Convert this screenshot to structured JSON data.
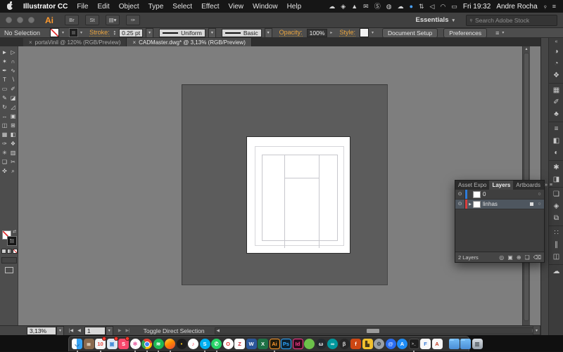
{
  "icons": {
    "close": "×",
    "dropdown": "▾",
    "dropdown_side": "▸",
    "stepper_up": "▴",
    "stepper_down": "▾",
    "scroll_up": "▴",
    "scroll_down": "▾",
    "scroll_left": "◀",
    "scroll_right": "▶",
    "nav_first": "|◀",
    "nav_prev": "◀",
    "nav_next": "▶",
    "nav_last": "▶|",
    "collapse": "«",
    "panel_chevron": "»",
    "panel_menu": "≡",
    "swap": "⇄",
    "search": "⌕"
  },
  "menubar": {
    "items": [
      "Illustrator CC",
      "File",
      "Edit",
      "Object",
      "Type",
      "Select",
      "Effect",
      "View",
      "Window",
      "Help"
    ],
    "status_icons": [
      {
        "name": "cloud-sync-icon",
        "glyph": "☁"
      },
      {
        "name": "shield-app-icon",
        "glyph": "◈"
      },
      {
        "name": "drive-triangle-icon",
        "glyph": "▲"
      },
      {
        "name": "chat-icon",
        "glyph": "✉"
      },
      {
        "name": "skype-status-icon",
        "glyph": "Ⓢ"
      },
      {
        "name": "globe-app-icon",
        "glyph": "◍"
      },
      {
        "name": "cloud2-icon",
        "glyph": "☁"
      },
      {
        "name": "blue-globe-icon",
        "glyph": "●",
        "color": "#4aa3ff"
      },
      {
        "name": "updown-arrows-icon",
        "glyph": "⇅"
      },
      {
        "name": "volume-icon",
        "glyph": "◁"
      },
      {
        "name": "wifi-icon",
        "glyph": "◠"
      },
      {
        "name": "battery-icon",
        "glyph": "▭"
      }
    ],
    "clock": "Fri 19:32",
    "user": "Andre Rocha",
    "search_icon": "⌕",
    "list_icon": "≡"
  },
  "titlebar": {
    "app_logo": "Ai",
    "icons": [
      {
        "name": "bridge-icon",
        "glyph": "Br"
      },
      {
        "name": "adobe-stock-icon",
        "glyph": "St"
      },
      {
        "name": "arrange-documents-icon",
        "glyph": "▤▾"
      },
      {
        "name": "share-icon",
        "glyph": "✑"
      }
    ],
    "workspace": "Essentials",
    "search_placeholder": "Search Adobe Stock"
  },
  "controlbar": {
    "selection_label": "No Selection",
    "stroke_label": "Stroke:",
    "stroke_weight": "0.25 pt",
    "width_profile": "Uniform",
    "brush": "Basic",
    "opacity_label": "Opacity:",
    "opacity_value": "100%",
    "style_label": "Style:",
    "document_setup": "Document Setup",
    "preferences": "Preferences"
  },
  "tabs": [
    {
      "title": "portaVinil @ 120% (RGB/Preview)",
      "active": false
    },
    {
      "title": "CADMaster.dwg* @ 3,13% (RGB/Preview)",
      "active": true
    }
  ],
  "toolbar": {
    "tools": [
      {
        "name": "selection-tool",
        "glyph": "►"
      },
      {
        "name": "direct-selection-tool",
        "glyph": "▷"
      },
      {
        "name": "magic-wand-tool",
        "glyph": "✶"
      },
      {
        "name": "lasso-tool",
        "glyph": "∩"
      },
      {
        "name": "pen-tool",
        "glyph": "✒"
      },
      {
        "name": "curvature-tool",
        "glyph": "∿"
      },
      {
        "name": "type-tool",
        "glyph": "T"
      },
      {
        "name": "line-segment-tool",
        "glyph": "∖"
      },
      {
        "name": "rectangle-tool",
        "glyph": "▭"
      },
      {
        "name": "paintbrush-tool",
        "glyph": "✐"
      },
      {
        "name": "pencil-tool",
        "glyph": "✎"
      },
      {
        "name": "eraser-tool",
        "glyph": "◪"
      },
      {
        "name": "rotate-tool",
        "glyph": "↻"
      },
      {
        "name": "scale-tool",
        "glyph": "◿"
      },
      {
        "name": "width-tool",
        "glyph": "↔"
      },
      {
        "name": "free-transform-tool",
        "glyph": "▣"
      },
      {
        "name": "shape-builder-tool",
        "glyph": "◫"
      },
      {
        "name": "perspective-grid-tool",
        "glyph": "⊞"
      },
      {
        "name": "mesh-tool",
        "glyph": "▦"
      },
      {
        "name": "gradient-tool",
        "glyph": "◧"
      },
      {
        "name": "eyedropper-tool",
        "glyph": "✑"
      },
      {
        "name": "blend-tool",
        "glyph": "❖"
      },
      {
        "name": "symbol-sprayer-tool",
        "glyph": "✳"
      },
      {
        "name": "column-graph-tool",
        "glyph": "▥"
      },
      {
        "name": "artboard-tool",
        "glyph": "❏"
      },
      {
        "name": "slice-tool",
        "glyph": "✂"
      },
      {
        "name": "hand-tool",
        "glyph": "✜"
      },
      {
        "name": "zoom-tool",
        "glyph": "⌕"
      }
    ]
  },
  "right_dock": {
    "groups": [
      [
        {
          "name": "color-panel-icon",
          "glyph": "◑"
        },
        {
          "name": "color-guide-panel-icon",
          "glyph": "◔"
        },
        {
          "name": "color-themes-panel-icon",
          "glyph": "❖"
        }
      ],
      [
        {
          "name": "swatches-panel-icon",
          "glyph": "▦"
        },
        {
          "name": "brushes-panel-icon",
          "glyph": "✐"
        },
        {
          "name": "symbols-panel-icon",
          "glyph": "♣"
        }
      ],
      [
        {
          "name": "stroke-panel-icon",
          "glyph": "≡"
        },
        {
          "name": "gradient-panel-icon",
          "glyph": "◧"
        },
        {
          "name": "transparency-panel-icon",
          "glyph": "◐"
        }
      ],
      [
        {
          "name": "appearance-panel-icon",
          "glyph": "✱"
        },
        {
          "name": "graphic-styles-panel-icon",
          "glyph": "◨"
        }
      ],
      [
        {
          "name": "artboards-panel-icon",
          "glyph": "❏"
        },
        {
          "name": "layers-panel-icon",
          "glyph": "◈"
        },
        {
          "name": "asset-export-panel-icon",
          "glyph": "⧉"
        }
      ],
      [
        {
          "name": "transform-panel-icon",
          "glyph": "∷"
        },
        {
          "name": "align-panel-icon",
          "glyph": "∥"
        },
        {
          "name": "pathfinder-panel-icon",
          "glyph": "◫"
        }
      ],
      [
        {
          "name": "cc-libraries-panel-icon",
          "glyph": "☁"
        }
      ]
    ]
  },
  "layers_panel": {
    "tabs": [
      "Asset Expo",
      "Layers",
      "Artboards"
    ],
    "active_tab": "Layers",
    "row_icons": {
      "eye": "⊙",
      "expand": "▶",
      "target": "○"
    },
    "rows": [
      {
        "name": "0",
        "color": "#2e7bd9",
        "selected": false,
        "expandable": false
      },
      {
        "name": "linhas",
        "color": "#d94040",
        "selected": true,
        "expandable": true
      }
    ],
    "footer": "2 Layers",
    "footer_icons": [
      {
        "name": "locate-object-icon",
        "glyph": "◎"
      },
      {
        "name": "clipping-mask-icon",
        "glyph": "▣"
      },
      {
        "name": "new-sublayer-icon",
        "glyph": "⊕"
      },
      {
        "name": "new-layer-icon",
        "glyph": "❏"
      },
      {
        "name": "delete-layer-icon",
        "glyph": "⌫"
      }
    ]
  },
  "statusbar": {
    "zoom": "3,13%",
    "artboard": "1",
    "status": "Toggle Direct Selection"
  },
  "dock": {
    "items": [
      {
        "name": "finder",
        "glyph": "◡",
        "fg": "#1a5f9e",
        "running": true
      },
      {
        "name": "notebook-app",
        "glyph": "≣",
        "bg": "#8a6a4e",
        "fg": "#e9dcc8"
      },
      {
        "name": "calendar",
        "glyph": "10",
        "bg": "#f4f4f4",
        "fg": "#e8463c",
        "badge": true,
        "running": true
      },
      {
        "name": "photos-album",
        "glyph": "▣",
        "bg": "#dfe9f2",
        "fg": "#4a90d9",
        "badge": true
      },
      {
        "name": "setapp",
        "glyph": "S",
        "bg": "#f5476b",
        "fg": "#ffffff",
        "badge": true
      },
      {
        "name": "photos",
        "glyph": "✻",
        "bg": "#ffffff",
        "fg": "#e85da0",
        "shape": "circle",
        "running": true
      },
      {
        "name": "chrome",
        "glyph": "",
        "shape": "circle",
        "running": true
      },
      {
        "name": "spotify",
        "glyph": "≋",
        "bg": "#1db954",
        "fg": "#ffffff",
        "shape": "circle",
        "running": true
      },
      {
        "name": "firefox",
        "glyph": "",
        "shape": "circle",
        "running": true
      },
      {
        "name": "vinyl-app",
        "glyph": "•",
        "bg": "#1c1c1c",
        "fg": "#f5c518",
        "shape": "circle"
      },
      {
        "name": "music",
        "glyph": "♪",
        "bg": "#ffffff",
        "fg": "#f5344f",
        "shape": "circle"
      },
      {
        "name": "skype",
        "glyph": "S",
        "bg": "#00aff0",
        "fg": "#ffffff",
        "shape": "circle",
        "running": true
      },
      {
        "name": "whatsapp",
        "glyph": "✆",
        "bg": "#25d366",
        "fg": "#ffffff",
        "shape": "circle",
        "running": true
      },
      {
        "name": "opera",
        "glyph": "O",
        "bg": "#ffffff",
        "fg": "#e8322e",
        "shape": "circle"
      },
      {
        "name": "zotero",
        "glyph": "Z",
        "bg": "#fdfdfd",
        "fg": "#cc2936"
      },
      {
        "name": "word",
        "glyph": "W",
        "bg": "#2b579a",
        "fg": "#ffffff"
      },
      {
        "name": "excel",
        "glyph": "X",
        "bg": "#1e7145",
        "fg": "#ffffff"
      },
      {
        "name": "illustrator",
        "glyph": "Ai",
        "bg": "#231c0c",
        "fg": "#ff9a2e",
        "running": true
      },
      {
        "name": "photoshop",
        "glyph": "Ps",
        "bg": "#0c2334",
        "fg": "#31a8ff"
      },
      {
        "name": "indesign",
        "glyph": "Id",
        "bg": "#2e0b1d",
        "fg": "#ff3f8e"
      },
      {
        "name": "green-app",
        "glyph": "",
        "bg": "#6cc04a",
        "shape": "circle"
      },
      {
        "name": "github",
        "glyph": "ω",
        "bg": "#24292e",
        "fg": "#ffffff",
        "shape": "circle"
      },
      {
        "name": "arduino",
        "glyph": "∞",
        "bg": "#00979d",
        "fg": "#ffffff",
        "shape": "circle"
      },
      {
        "name": "processing",
        "glyph": "β",
        "bg": "#262626",
        "fg": "#dcdcdc",
        "shape": "circle"
      },
      {
        "name": "fritzing",
        "glyph": "f",
        "bg": "#cd4713",
        "fg": "#ffffff"
      },
      {
        "name": "truck-app",
        "glyph": "▙",
        "bg": "#f2c12e",
        "fg": "#4a3a1a"
      },
      {
        "name": "gear-app",
        "glyph": "⚙",
        "bg": "#9aa0a6",
        "fg": "#40464c",
        "shape": "circle"
      },
      {
        "name": "blue-app",
        "glyph": "@",
        "bg": "#2a6df0",
        "fg": "#cfe0ff",
        "shape": "circle"
      },
      {
        "name": "appstore",
        "glyph": "A",
        "bg": "#1f8df5",
        "fg": "#ffffff",
        "shape": "circle"
      },
      {
        "name": "terminal",
        "glyph": ">_",
        "bg": "#1e1e1e",
        "fg": "#cfcfcf",
        "running": true
      },
      {
        "name": "font-app",
        "glyph": "F",
        "bg": "#f8f8f8",
        "fg": "#3a7bd5"
      },
      {
        "name": "autocad",
        "glyph": "A",
        "bg": "#f8f8f8",
        "fg": "#c23b22"
      },
      {
        "separator": true,
        "name": "separator"
      },
      {
        "name": "folder-applications",
        "glyph": ""
      },
      {
        "name": "folder-downloads",
        "glyph": ""
      },
      {
        "name": "trash",
        "glyph": "▥"
      }
    ]
  }
}
